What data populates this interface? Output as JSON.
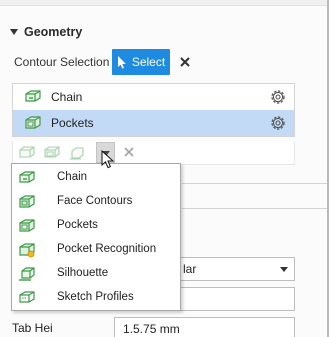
{
  "geometry": {
    "title": "Geometry",
    "contour_selection_label": "Contour Selection",
    "select_label": "Select",
    "selection_list": [
      {
        "label": "Chain",
        "icon": "chain-icon",
        "selected": false
      },
      {
        "label": "Pockets",
        "icon": "pockets-icon",
        "selected": true
      }
    ]
  },
  "dropdown_menu": {
    "items": [
      {
        "label": "Chain",
        "icon": "chain-icon"
      },
      {
        "label": "Face Contours",
        "icon": "face-contours-icon"
      },
      {
        "label": "Pockets",
        "icon": "pockets-icon"
      },
      {
        "label": "Pocket Recognition",
        "icon": "pocket-recognition-icon"
      },
      {
        "label": "Silhouette",
        "icon": "silhouette-icon"
      },
      {
        "label": "Sketch Profiles",
        "icon": "sketch-profiles-icon"
      }
    ]
  },
  "background_fields": {
    "select_value_partial": "lar",
    "row3_label_partial": "Tab Hei",
    "row3_value_partial": "1.5.75 mm"
  },
  "colors": {
    "accent": "#1f8be0",
    "selected_row": "#c3daf6",
    "icon_green": "#3f9a48"
  }
}
